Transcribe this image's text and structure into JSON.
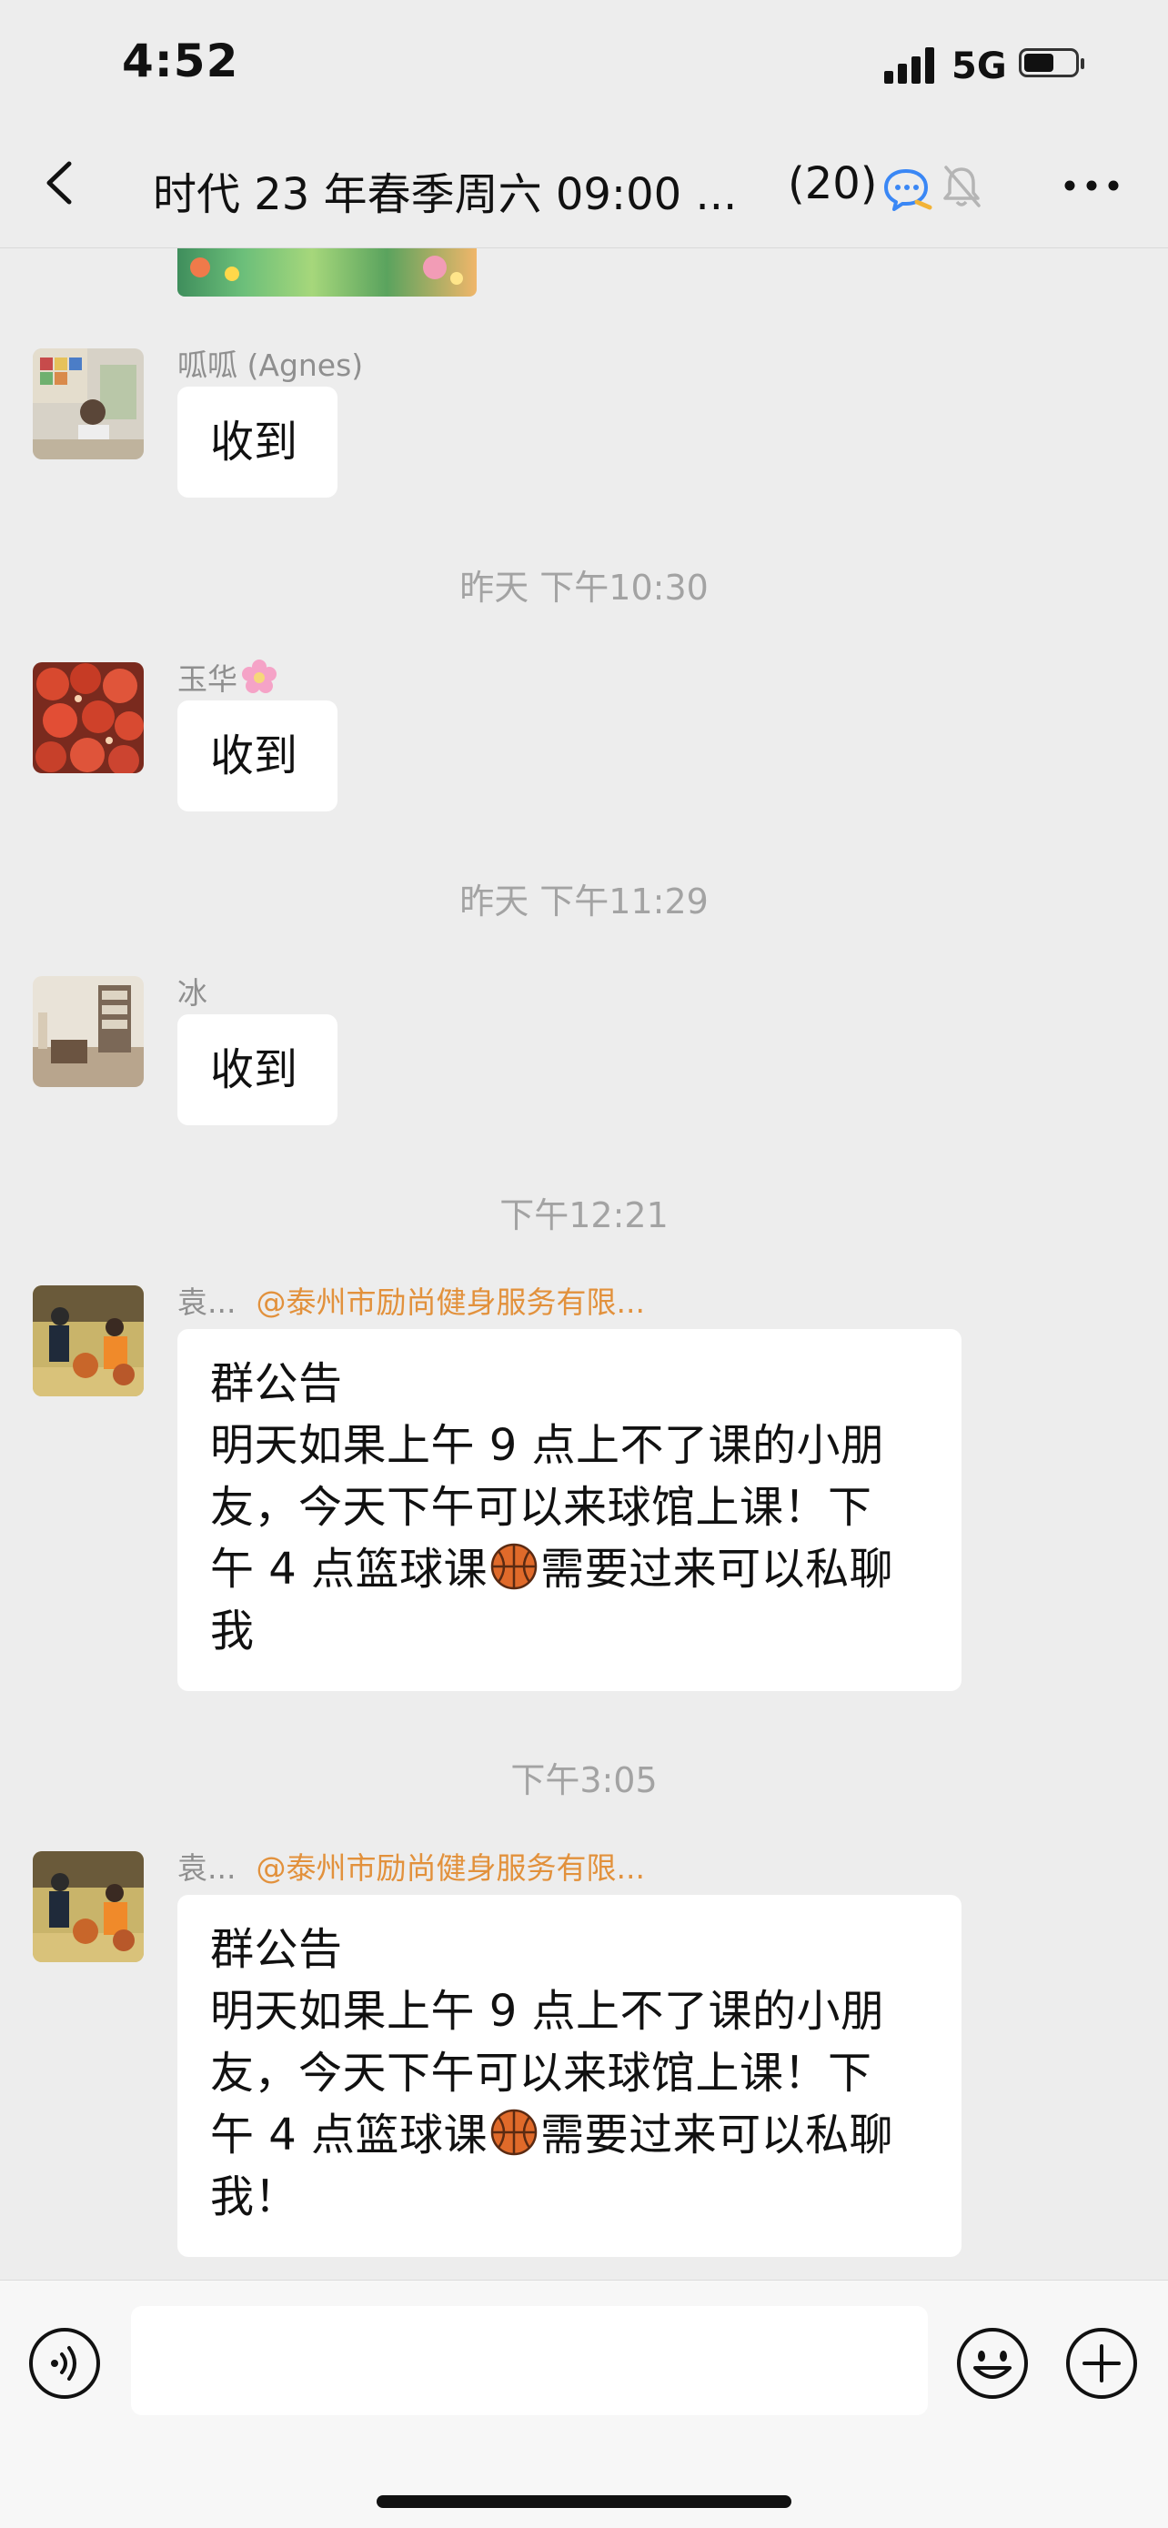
{
  "status_bar": {
    "time": "4:52",
    "network": "5G"
  },
  "header": {
    "title": "时代 23 年春季周六 09:00 ...",
    "member_count": "(20)"
  },
  "messages": [
    {
      "sender": "呱呱 (Agnes)",
      "text": "收到"
    },
    {
      "timestamp": "昨天 下午10:30",
      "sender": "玉华",
      "text": "收到"
    },
    {
      "timestamp": "昨天 下午11:29",
      "sender": "冰",
      "text": "收到"
    },
    {
      "timestamp": "下午12:21",
      "sender": "袁...",
      "mention": "@泰州市励尚健身服务有限...",
      "lines": [
        "群公告",
        "明天如果上午 9 点上不了课的小朋",
        "友，今天下午可以来球馆上课！下",
        "午 4 点篮球课",
        "需要过来可以私聊",
        "我"
      ]
    },
    {
      "timestamp": "下午3:05",
      "sender": "袁...",
      "mention": "@泰州市励尚健身服务有限...",
      "lines": [
        "群公告",
        "明天如果上午 9 点上不了课的小朋",
        "友，今天下午可以来球馆上课！下",
        "午 4 点篮球课",
        "需要过来可以私聊",
        "我！"
      ]
    }
  ],
  "input": {
    "value": "",
    "placeholder": ""
  },
  "icons": {
    "back": "chevron-left-icon",
    "chat_bubble": "chat-bubble-icon",
    "mute": "bell-muted-icon",
    "more": "more-dots-icon",
    "voice": "voice-icon",
    "emoji": "emoji-icon",
    "plus": "plus-icon",
    "ball": "basketball-icon",
    "flower": "flower-icon"
  },
  "colors": {
    "background": "#ededed",
    "bubble": "#ffffff",
    "mention": "#e2913c",
    "timestamp": "#a3a3a3"
  }
}
